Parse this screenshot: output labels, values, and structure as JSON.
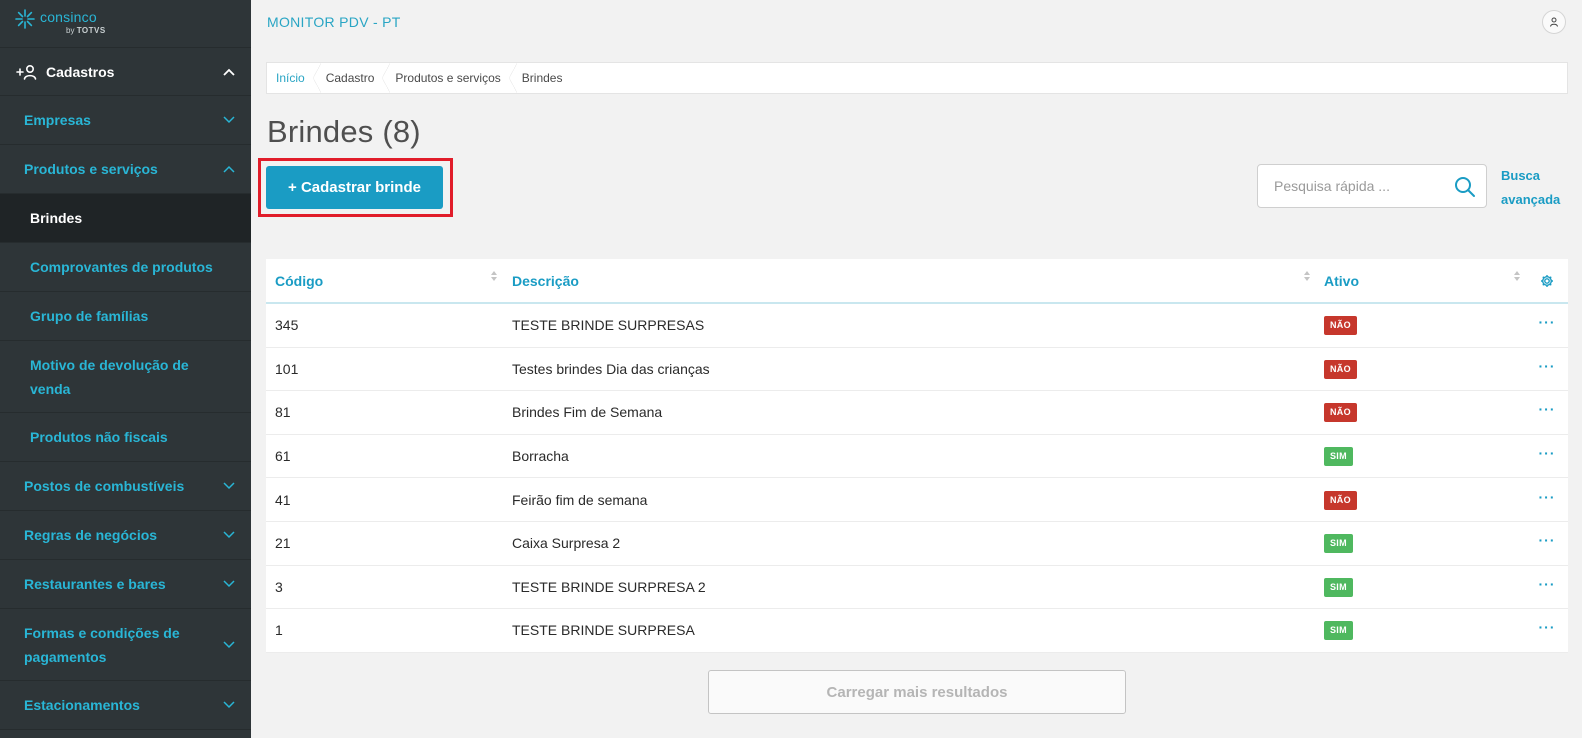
{
  "brand": {
    "name": "consinco",
    "by": "by",
    "partner": "TOTVS"
  },
  "sidebar": {
    "root": {
      "label": "Cadastros"
    },
    "items": [
      {
        "label": "Empresas"
      },
      {
        "label": "Produtos e serviços"
      }
    ],
    "subitems": [
      {
        "label": "Brindes"
      },
      {
        "label": "Comprovantes de produtos"
      },
      {
        "label": "Grupo de famílias"
      },
      {
        "label": "Motivo de devolução de venda"
      },
      {
        "label": "Produtos não fiscais"
      }
    ],
    "more_items": [
      {
        "label": "Postos de combustíveis"
      },
      {
        "label": "Regras de negócios"
      },
      {
        "label": "Restaurantes e bares"
      },
      {
        "label": "Formas e condições de pagamentos"
      },
      {
        "label": "Estacionamentos"
      }
    ]
  },
  "header": {
    "title": "MONITOR PDV - PT"
  },
  "breadcrumb": [
    "Início",
    "Cadastro",
    "Produtos e serviços",
    "Brindes"
  ],
  "page": {
    "title": "Brindes (8)",
    "add_button": "+  Cadastrar brinde",
    "search_placeholder": "Pesquisa rápida ...",
    "advanced_search": "Busca avançada",
    "load_more": "Carregar mais resultados"
  },
  "table": {
    "columns": [
      "Código",
      "Descrição",
      "Ativo"
    ],
    "rows": [
      {
        "code": "345",
        "desc": "TESTE BRINDE SURPRESAS",
        "active": "NÃO",
        "more": "···"
      },
      {
        "code": "101",
        "desc": "Testes brindes Dia das crianças",
        "active": "NÃO",
        "more": "···"
      },
      {
        "code": "81",
        "desc": "Brindes Fim de Semana",
        "active": "NÃO",
        "more": "···"
      },
      {
        "code": "61",
        "desc": "Borracha",
        "active": "SIM",
        "more": "···"
      },
      {
        "code": "41",
        "desc": "Feirão fim de semana",
        "active": "NÃO",
        "more": "···"
      },
      {
        "code": "21",
        "desc": "Caixa Surpresa 2",
        "active": "SIM",
        "more": "···"
      },
      {
        "code": "3",
        "desc": "TESTE BRINDE SURPRESA 2",
        "active": "SIM",
        "more": "···"
      },
      {
        "code": "1",
        "desc": "TESTE BRINDE SURPRESA",
        "active": "SIM",
        "more": "···"
      }
    ]
  },
  "colors": {
    "accent": "#1a9cc4",
    "sidebar_bg": "#2e3538",
    "badge_no": "#c6372c",
    "badge_yes": "#4fb85f",
    "highlight": "#e11d2a"
  }
}
